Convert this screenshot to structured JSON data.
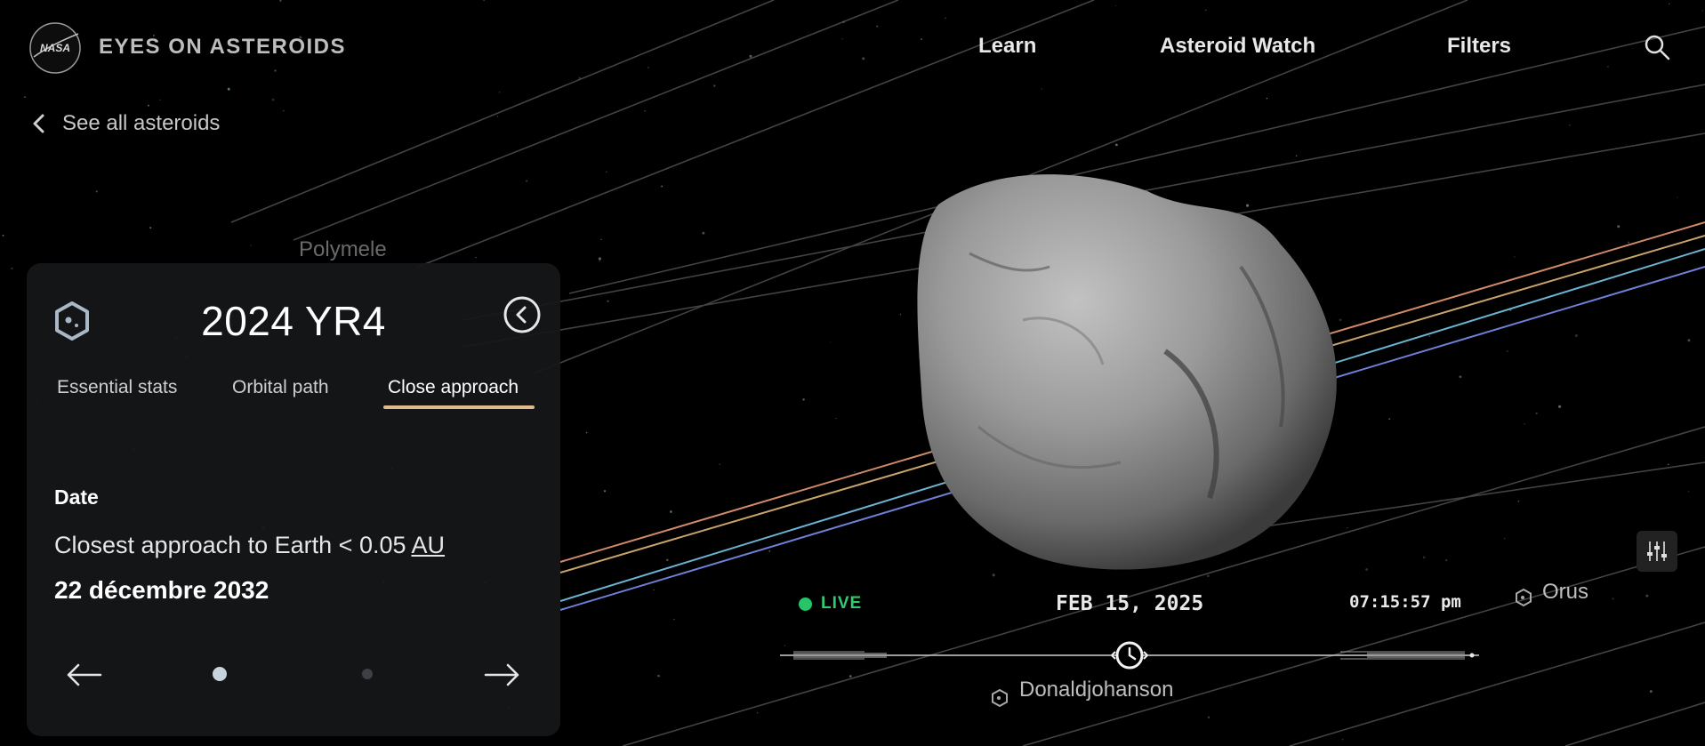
{
  "header": {
    "brand_text": "EYES ON ASTEROIDS",
    "logo_text": "NASA",
    "nav": [
      {
        "label": "Learn"
      },
      {
        "label": "Asteroid Watch"
      },
      {
        "label": "Filters"
      }
    ],
    "search_icon": "search-icon"
  },
  "back_link": {
    "label": "See all asteroids",
    "icon": "chevron-left-icon"
  },
  "scene": {
    "labels": {
      "polymele": "Polymele",
      "orus": "Orus",
      "donaldjohanson": "Donaldjohanson"
    },
    "orbit_colors": [
      "#d08a6a",
      "#c9a46a",
      "#6ab3d1",
      "#6f7fd6"
    ]
  },
  "panel": {
    "title": "2024 YR4",
    "icon": "asteroid-icon",
    "collapse_icon": "chevron-left-circle-icon",
    "tabs": [
      {
        "label": "Essential stats"
      },
      {
        "label": "Orbital path"
      },
      {
        "label": "Close approach",
        "active": true
      }
    ],
    "accent": "#e0b98c",
    "section_label": "Date",
    "approach_text": "Closest approach to Earth < 0.05 ",
    "approach_unit": "AU",
    "date_value": "22 décembre 2032",
    "pager": {
      "prev_icon": "arrow-left-icon",
      "next_icon": "arrow-right-icon",
      "page": 1,
      "pages": 2
    }
  },
  "timeline": {
    "live_label": "LIVE",
    "live_color": "#2ecc71",
    "date": "FEB 15, 2025",
    "time": "07:15:57 pm",
    "clock_icon": "clock-icon"
  },
  "settings_icon": "sliders-icon"
}
